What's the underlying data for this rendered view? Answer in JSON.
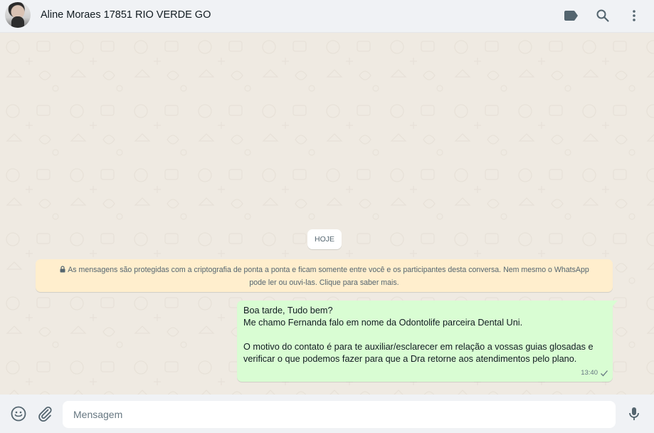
{
  "header": {
    "contact_name": "Aline Moraes 17851 RIO VERDE GO",
    "icons": [
      "label-icon",
      "search-icon",
      "menu-icon"
    ]
  },
  "chat": {
    "date_label": "HOJE",
    "encryption_notice": {
      "line1": "As mensagens são protegidas com a criptografia de ponta a ponta e ficam somente entre você e os participantes desta conversa. Nem mesmo o WhatsApp",
      "line2": "pode ler ou ouvi-las. Clique para saber mais."
    },
    "messages": [
      {
        "direction": "outgoing",
        "lines": [
          "Boa tarde, Tudo bem?",
          "Me chamo Fernanda falo em nome da Odontolife parceira Dental Uni.",
          "",
          "O motivo do contato é para te auxiliar/esclarecer em relação a vossas guias glosadas e",
          "verificar o que podemos fazer para que a Dra retorne aos atendimentos pelo plano."
        ],
        "time": "13:40",
        "status": "sent"
      }
    ]
  },
  "composer": {
    "placeholder": "Mensagem",
    "value": "",
    "icons": [
      "emoji-icon",
      "attach-icon",
      "mic-icon"
    ]
  },
  "colors": {
    "outgoing_bubble": "#d9fdd3",
    "notice_bg": "#ffeecd",
    "chat_bg": "#efeae2",
    "header_bg": "#f0f2f5"
  }
}
